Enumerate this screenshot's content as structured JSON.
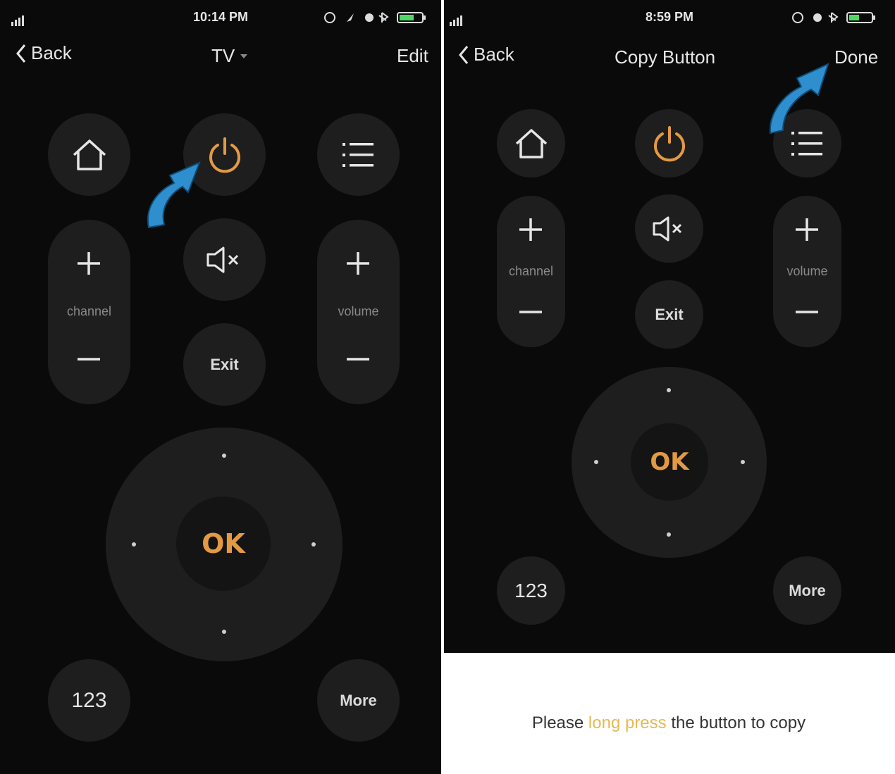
{
  "left": {
    "status": {
      "time": "10:14 PM"
    },
    "nav": {
      "back": "Back",
      "title": "TV",
      "right": "Edit"
    },
    "remote": {
      "channel_label": "channel",
      "volume_label": "volume",
      "exit_label": "Exit",
      "ok_label": "OK",
      "numbers_label": "123",
      "more_label": "More"
    }
  },
  "right": {
    "status": {
      "time": "8:59 PM"
    },
    "nav": {
      "back": "Back",
      "title": "Copy Button",
      "right": "Done"
    },
    "remote": {
      "channel_label": "channel",
      "volume_label": "volume",
      "exit_label": "Exit",
      "ok_label": "OK",
      "numbers_label": "123",
      "more_label": "More"
    }
  },
  "hint": {
    "before": "Please ",
    "highlight": "long press",
    "after": " the button to copy"
  },
  "colors": {
    "background": "#0a0a0a",
    "button": "#1e1e1e",
    "accent": "#e39a42",
    "arrow": "#2f8fce",
    "highlight": "#e7b955"
  }
}
